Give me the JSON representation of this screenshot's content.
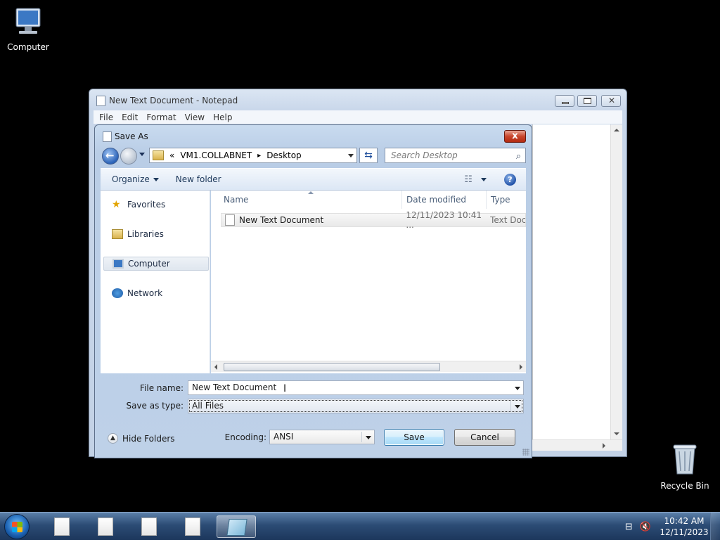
{
  "desktop": {
    "computer_label": "Computer",
    "recycle_label": "Recycle Bin"
  },
  "notepad": {
    "title": "New Text Document - Notepad",
    "menu": [
      "File",
      "Edit",
      "Format",
      "View",
      "Help"
    ]
  },
  "dialog": {
    "title": "Save As",
    "close_glyph": "x",
    "address": {
      "chevron": "«",
      "crumbs": [
        "VM1.COLLABNET",
        "Desktop"
      ],
      "separator": "▸"
    },
    "search_placeholder": "Search Desktop",
    "toolbar": {
      "organize": "Organize",
      "new_folder": "New folder",
      "help_glyph": "?"
    },
    "nav": {
      "favorites": "Favorites",
      "libraries": "Libraries",
      "computer": "Computer",
      "network": "Network"
    },
    "columns": {
      "name": "Name",
      "date": "Date modified",
      "type": "Type"
    },
    "files": [
      {
        "name": "New Text Document",
        "date": "12/11/2023 10:41 ...",
        "type": "Text Document"
      }
    ],
    "file_name_label": "File name:",
    "file_name_value": "New Text Document",
    "save_type_label": "Save as type:",
    "save_type_value": "All Files",
    "hide_folders": "Hide Folders",
    "encoding_label": "Encoding:",
    "encoding_value": "ANSI",
    "save_button": "Save",
    "cancel_button": "Cancel"
  },
  "taskbar": {
    "time": "10:42 AM",
    "date": "12/11/2023"
  }
}
